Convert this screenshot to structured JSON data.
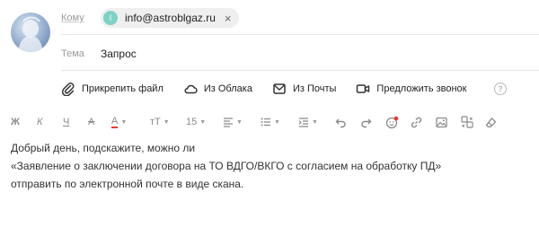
{
  "header": {
    "to_label": "Кому",
    "recipient": {
      "initial": "I",
      "email": "info@astroblgaz.ru",
      "remove_symbol": "×"
    },
    "subject_label": "Тема",
    "subject_value": "Запрос"
  },
  "attach_bar": {
    "attach_file": "Прикрепить файл",
    "from_cloud": "Из Облака",
    "from_mail": "Из Почты",
    "suggest_call": "Предложить звонок",
    "help_symbol": "?"
  },
  "format_bar": {
    "bold": "Ж",
    "italic": "К",
    "underline": "Ч",
    "strike": "А",
    "text_color": "А",
    "font_size_icon": "тТ",
    "font_size_value": "15"
  },
  "message": {
    "lines": [
      "Добрый день, подскажите, можно ли",
      "«Заявление о заключении договора на ТО ВДГО/ВКГО с согласием на обработку ПД»",
      "отправить по электронной почте в виде скана."
    ]
  },
  "colors": {
    "chip_avatar": "#7fd1c4",
    "emoji_dot": "#e53935",
    "text_color_underline": "#e53935"
  }
}
